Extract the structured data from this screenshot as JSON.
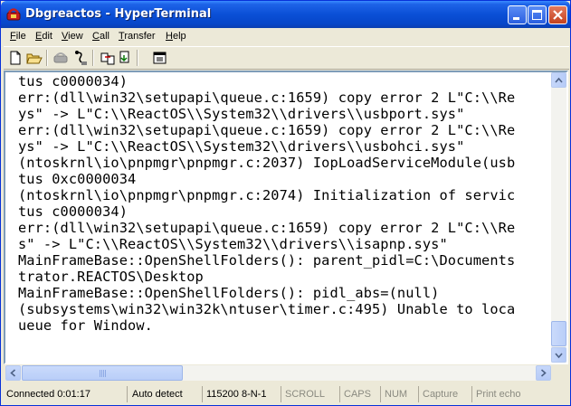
{
  "window": {
    "title": "Dbgreactos - HyperTerminal"
  },
  "menu": [
    {
      "label": "File",
      "key": "F",
      "rest": "ile"
    },
    {
      "label": "Edit",
      "key": "E",
      "rest": "dit"
    },
    {
      "label": "View",
      "key": "V",
      "rest": "iew"
    },
    {
      "label": "Call",
      "key": "C",
      "rest": "all"
    },
    {
      "label": "Transfer",
      "key": "T",
      "rest": "ransfer"
    },
    {
      "label": "Help",
      "key": "H",
      "rest": "elp"
    }
  ],
  "toolbar": {
    "icons": [
      "new-icon",
      "open-icon",
      "connect-icon",
      "disconnect-icon",
      "send-icon",
      "properties-icon"
    ]
  },
  "terminal": {
    "lines": [
      "tus c0000034)",
      "err:(dll\\win32\\setupapi\\queue.c:1659) copy error 2 L\"C:\\\\Re",
      "ys\" -> L\"C:\\\\ReactOS\\\\System32\\\\drivers\\\\usbport.sys\"",
      "err:(dll\\win32\\setupapi\\queue.c:1659) copy error 2 L\"C:\\\\Re",
      "ys\" -> L\"C:\\\\ReactOS\\\\System32\\\\drivers\\\\usbohci.sys\"",
      "(ntoskrnl\\io\\pnpmgr\\pnpmgr.c:2037) IopLoadServiceModule(usb",
      "tus 0xc0000034",
      "(ntoskrnl\\io\\pnpmgr\\pnpmgr.c:2074) Initialization of servic",
      "tus c0000034)",
      "err:(dll\\win32\\setupapi\\queue.c:1659) copy error 2 L\"C:\\\\Re",
      "s\" -> L\"C:\\\\ReactOS\\\\System32\\\\drivers\\\\isapnp.sys\"",
      "MainFrameBase::OpenShellFolders(): parent_pidl=C:\\Documents",
      "trator.REACTOS\\Desktop",
      "MainFrameBase::OpenShellFolders(): pidl_abs=(null)",
      "(subsystems\\win32\\win32k\\ntuser\\timer.c:495) Unable to loca",
      "ueue for Window."
    ]
  },
  "status": {
    "connected": "Connected 0:01:17",
    "detect": "Auto detect",
    "settings": "115200 8-N-1",
    "scroll": "SCROLL",
    "caps": "CAPS",
    "num": "NUM",
    "capture": "Capture",
    "print_echo": "Print echo"
  }
}
